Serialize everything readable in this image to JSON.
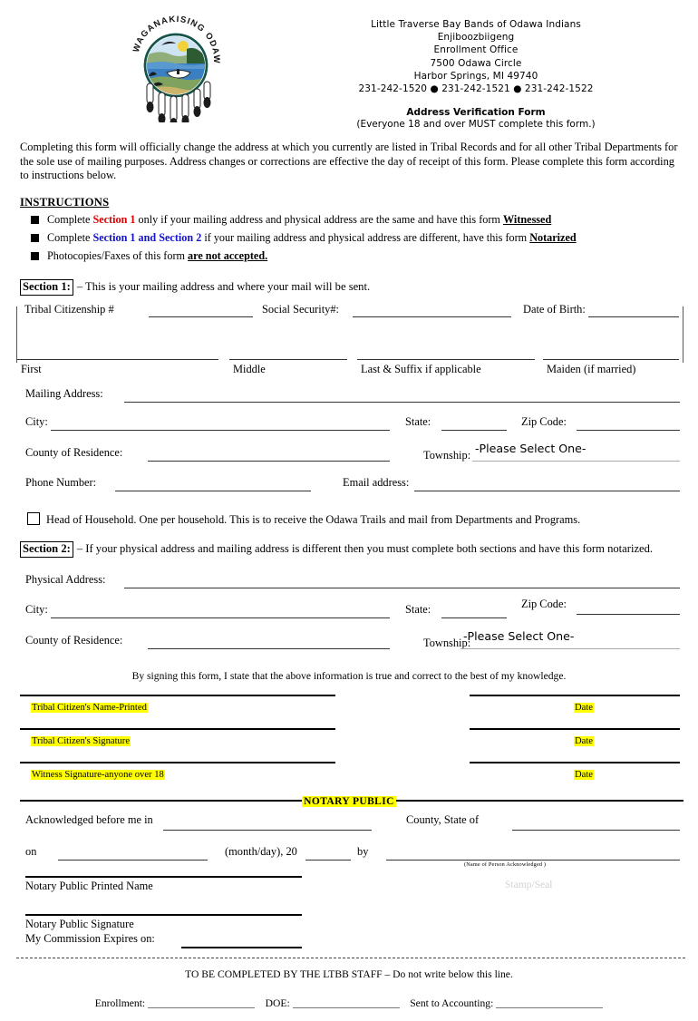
{
  "header": {
    "logo_alt": "Waganakising Odawa tribal seal",
    "logo_ring_text": "WAGANAKISING ODAWA",
    "org_lines": [
      "Little Traverse Bay Bands of Odawa Indians",
      "Enjiboozbiigeng",
      "Enrollment Office",
      "7500 Odawa Circle",
      "Harbor Springs, MI 49740",
      "231-242-1520 ● 231-242-1521 ● 231-242-1522"
    ],
    "form_title": "Address Verification Form",
    "form_subtitle": "(Everyone 18 and over MUST complete this form.)"
  },
  "intro": "Completing this form will officially change the address at which you currently are listed in Tribal Records and for all other Tribal Departments for the sole use of mailing purposes.  Address changes or corrections are effective the day of receipt of this form.  Please complete this form according to instructions below.",
  "instructions": {
    "title": "INSTRUCTIONS",
    "items": [
      {
        "a": "Complete ",
        "em1": "Section 1",
        "em1_color": "#e00000",
        "b": " only if your mailing address and physical address are the same and have this form ",
        "em2": "Witnessed",
        "c": ""
      },
      {
        "a": "Complete  ",
        "em1": "Section 1 and Section 2",
        "em1_color": "#1414c8",
        "b": " if your mailing address and physical address are different, have this form ",
        "em2": "Notarized",
        "c": ""
      },
      {
        "a": "Photocopies/Faxes of this form ",
        "em1": "",
        "em1_color": "#000000",
        "b": "",
        "em2": "are not accepted.",
        "c": ""
      }
    ]
  },
  "section1": {
    "tag": "Section 1:",
    "desc": "– This is your mailing address and where your mail will be sent.",
    "tribal_citizenship_label": "Tribal Citizenship #",
    "ssn_label": "Social Security#:",
    "dob_label": "Date of Birth:",
    "name_labels": [
      "First",
      "Middle",
      "Last & Suffix if applicable",
      "Maiden (if married)"
    ],
    "mailing_address_label": "Mailing Address:",
    "city_label": "City:",
    "state_label": "State:",
    "zip_label": "Zip Code:",
    "county_label": "County of Residence:",
    "township_label": "Township:",
    "township_value": "-Please Select One-",
    "phone_label": "Phone Number:",
    "email_label": "Email address:",
    "hoh_text": "Head of Household.  One per household. This is to receive the Odawa Trails and mail from Departments and Programs.",
    "values": {
      "tribal_citizenship": "",
      "ssn": "",
      "dob": "",
      "first": "",
      "middle": "",
      "last": "",
      "maiden": "",
      "mailing_address": "",
      "city": "",
      "state": "",
      "zip": "",
      "county": "",
      "phone": "",
      "email": ""
    }
  },
  "section2": {
    "tag": "Section 2:",
    "desc": "– If your physical address and mailing address is different then you must complete both sections and have this form notarized.",
    "physical_address_label": "Physical Address:",
    "city_label": "City:",
    "state_label": "State:",
    "zip_label": "Zip Code:",
    "county_label": "County of Residence:",
    "township_label": "Township:",
    "township_value": "-Please Select One-",
    "values": {
      "physical_address": "",
      "city": "",
      "state": "",
      "zip": "",
      "county": ""
    }
  },
  "attestation": "By signing this form, I state that the above information is true and correct to the best of my knowledge.",
  "signatures": [
    {
      "label": "Tribal Citizen's Name-Printed",
      "date_label": "Date"
    },
    {
      "label": "Tribal Citizen's Signature",
      "date_label": "Date"
    },
    {
      "label": "Witness Signature-anyone over 18",
      "date_label": "Date"
    }
  ],
  "notary": {
    "title": "NOTARY PUBLIC",
    "ack_label": "Acknowledged before me in",
    "county_state_label": "County, State of",
    "on_label": "on",
    "monthday_label": "(month/day), 20",
    "by_label": "by",
    "name_of_person_caption": "(Name of Person  Acknowledged )",
    "printed_name_label": "Notary Public Printed Name",
    "stamp_seal_label": "Stamp/Seal",
    "signature_label": "Notary Public Signature",
    "commission_label": "My Commission Expires on:"
  },
  "staff": {
    "note": "TO BE COMPLETED BY THE LTBB STAFF – Do not write below this line.",
    "fields": [
      {
        "label": "Enrollment:"
      },
      {
        "label": "DOE:"
      },
      {
        "label": "Sent to Accounting:"
      }
    ]
  },
  "colors": {
    "highlight": "#ffff00",
    "section1_accent": "#e00000",
    "section2_accent": "#1414c8",
    "rule": "#333333"
  }
}
